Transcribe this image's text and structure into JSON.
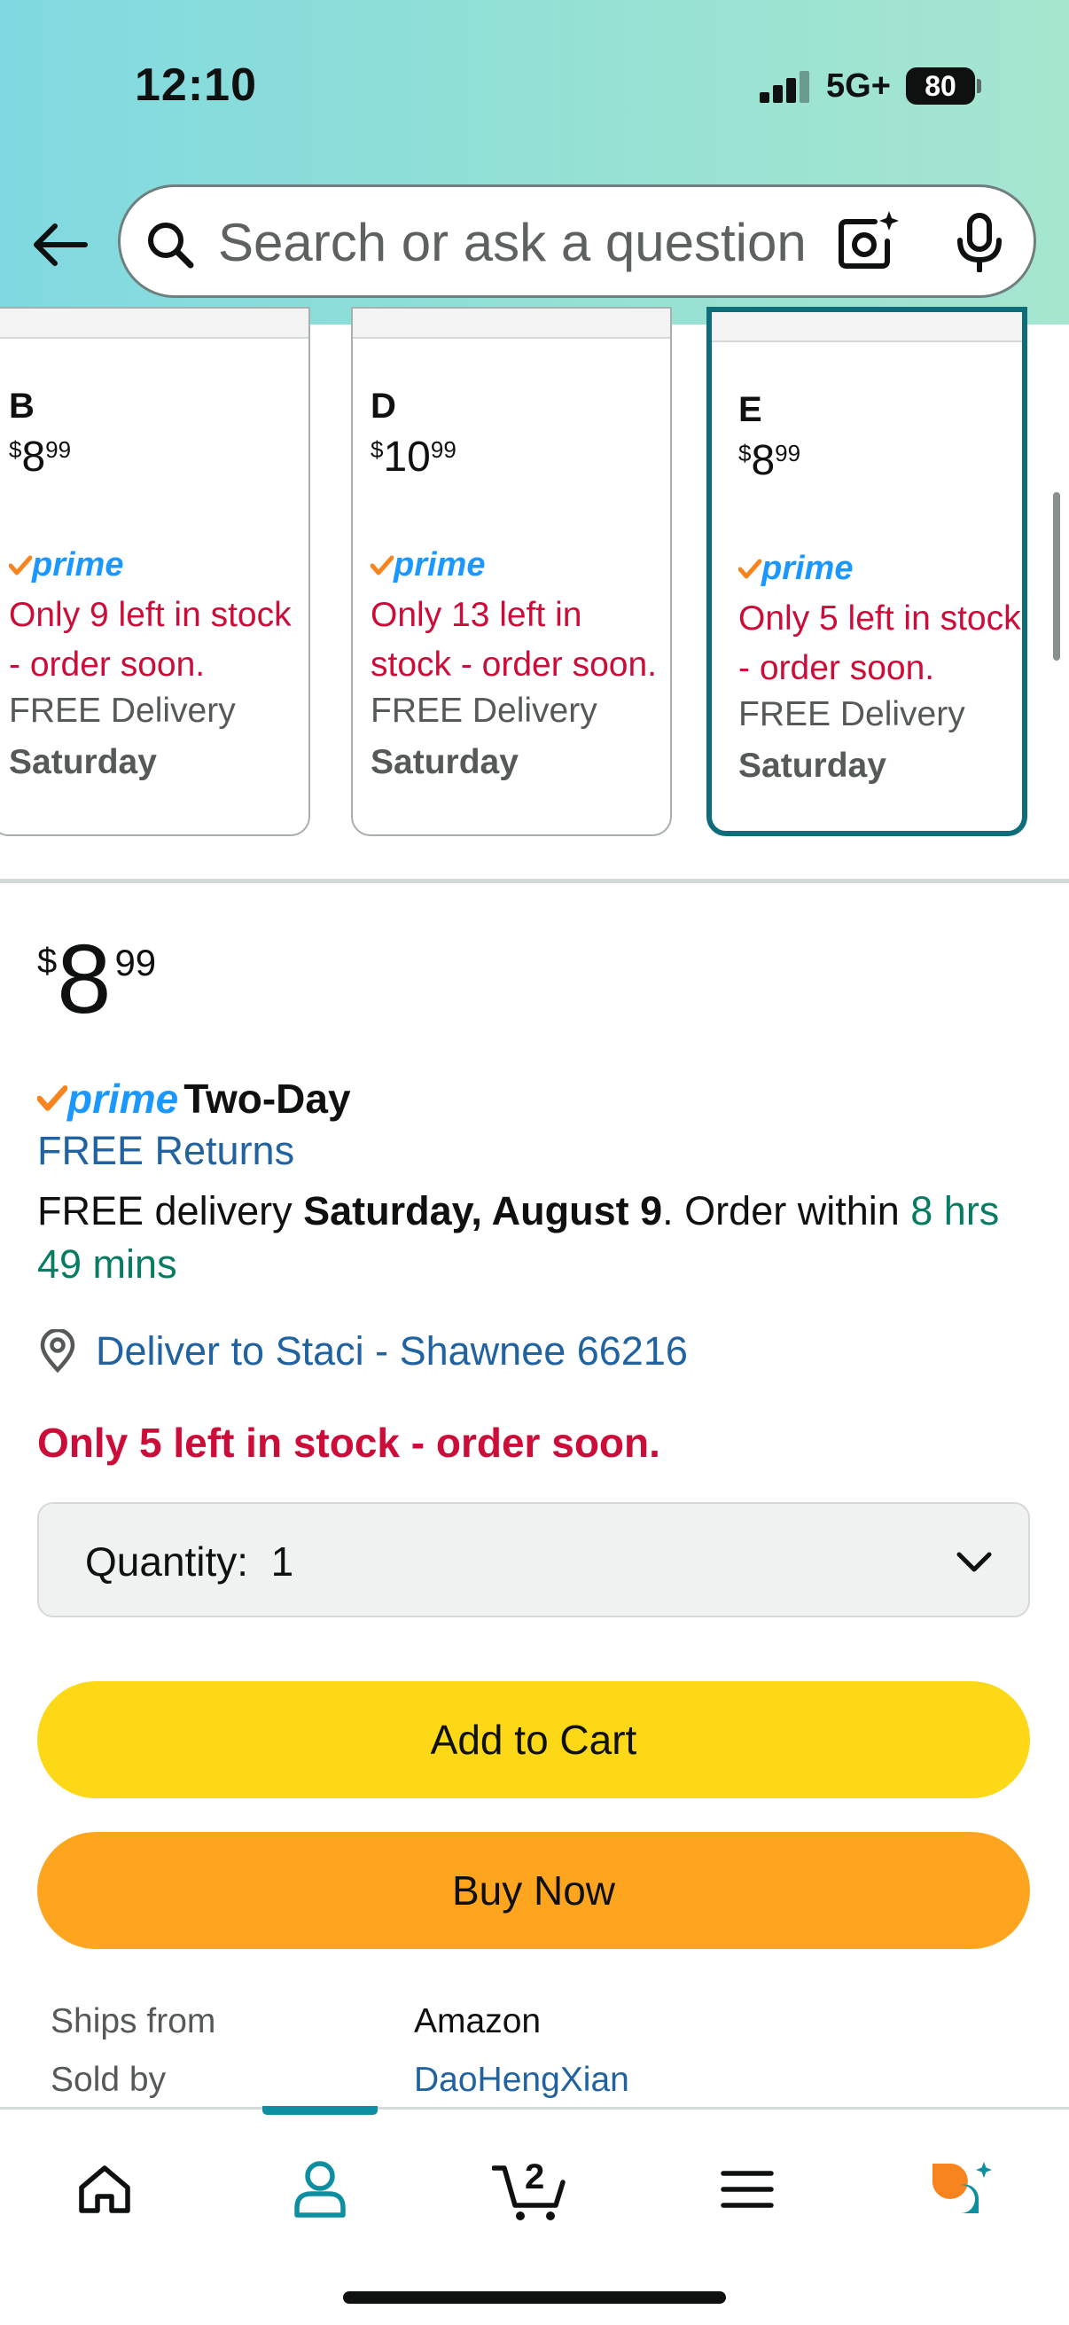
{
  "status_bar": {
    "time": "12:10",
    "network": "5G+",
    "battery": "80"
  },
  "search": {
    "placeholder": "Search or ask a question"
  },
  "variants": [
    {
      "letter": "B",
      "price_symbol": "$",
      "price_whole": "8",
      "price_cents": "99",
      "prime": "prime",
      "stock": "Only 9 left in stock - order soon.",
      "delivery": "FREE Delivery",
      "day": "Saturday",
      "selected": false
    },
    {
      "letter": "D",
      "price_symbol": "$",
      "price_whole": "10",
      "price_cents": "99",
      "prime": "prime",
      "stock": "Only 13 left in stock - order soon.",
      "delivery": "FREE Delivery",
      "day": "Saturday",
      "selected": false
    },
    {
      "letter": "E",
      "price_symbol": "$",
      "price_whole": "8",
      "price_cents": "99",
      "prime": "prime",
      "stock": "Only 5 left in stock - order soon.",
      "delivery": "FREE Delivery",
      "day": "Saturday",
      "selected": true
    }
  ],
  "buybox": {
    "price_symbol": "$",
    "price_whole": "8",
    "price_cents": "99",
    "prime": "prime",
    "prime_speed": "Two-Day",
    "free_returns": "FREE Returns",
    "delivery_prefix": "FREE delivery ",
    "delivery_date": "Saturday, August 9",
    "delivery_mid": ". Order within ",
    "delivery_countdown": "8 hrs 49 mins",
    "deliver_to": "Deliver to Staci - Shawnee 66216",
    "stock_warning": "Only 5 left in stock - order soon.",
    "quantity_label": "Quantity:",
    "quantity_value": "1",
    "add_to_cart": "Add to Cart",
    "buy_now": "Buy Now",
    "ships_from_label": "Ships from",
    "ships_from_value": "Amazon",
    "sold_by_label": "Sold by",
    "sold_by_value": "DaoHengXian"
  },
  "bottom_nav": {
    "cart_count": "2",
    "active": "account"
  },
  "colors": {
    "accent": "#0e8fa1",
    "prime_blue": "#1a98ff",
    "prime_check": "#f7841f",
    "alert_red": "#cc0c39",
    "link_blue": "#2162a1",
    "cart_yellow": "#fcd816",
    "buy_orange": "#fea520"
  }
}
